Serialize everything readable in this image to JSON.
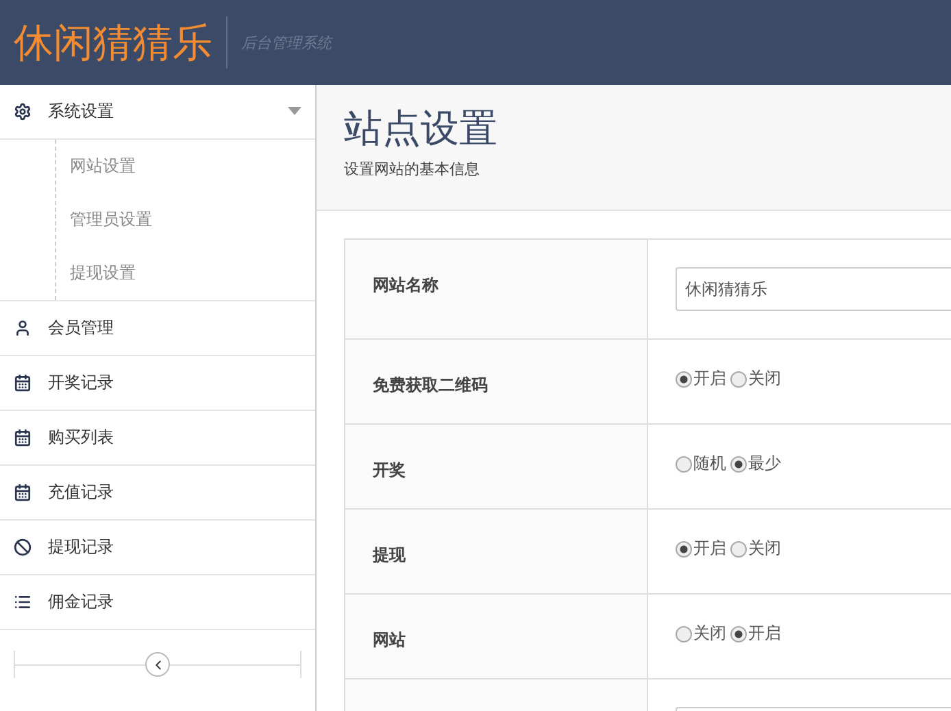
{
  "header": {
    "logo": "休闲猜猜乐",
    "subtitle": "后台管理系统"
  },
  "sidebar": {
    "items": [
      {
        "label": "系统设置",
        "expanded": true,
        "children": [
          {
            "label": "网站设置"
          },
          {
            "label": "管理员设置"
          },
          {
            "label": "提现设置"
          }
        ]
      },
      {
        "label": "会员管理"
      },
      {
        "label": "开奖记录"
      },
      {
        "label": "购买列表"
      },
      {
        "label": "充值记录"
      },
      {
        "label": "提现记录"
      },
      {
        "label": "佣金记录"
      }
    ]
  },
  "page": {
    "title": "站点设置",
    "subtitle": "设置网站的基本信息"
  },
  "form": {
    "rows": [
      {
        "kind": "text",
        "label": "网站名称",
        "value": "休闲猜猜乐"
      },
      {
        "kind": "radio",
        "label": "免费获取二维码",
        "options": [
          {
            "label": "开启",
            "selected": true
          },
          {
            "label": "关闭",
            "selected": false
          }
        ]
      },
      {
        "kind": "radio",
        "label": "开奖",
        "options": [
          {
            "label": "随机",
            "selected": false
          },
          {
            "label": "最少",
            "selected": true
          }
        ]
      },
      {
        "kind": "radio",
        "label": "提现",
        "options": [
          {
            "label": "开启",
            "selected": true
          },
          {
            "label": "关闭",
            "selected": false
          }
        ]
      },
      {
        "kind": "radio",
        "label": "网站",
        "options": [
          {
            "label": "关闭",
            "selected": false
          },
          {
            "label": "开启",
            "selected": true
          }
        ]
      },
      {
        "kind": "text"
      }
    ]
  }
}
